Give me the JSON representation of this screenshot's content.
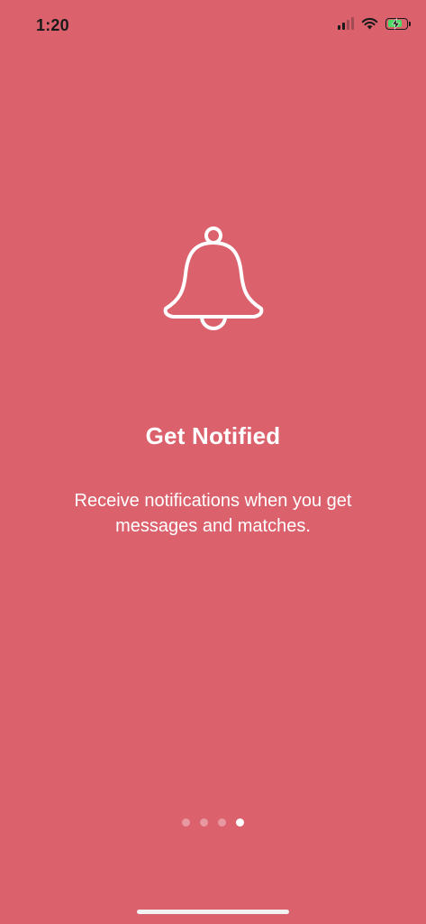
{
  "status_bar": {
    "time": "1:20",
    "signal_icon": "cellular-signal-icon",
    "wifi_icon": "wifi-icon",
    "battery_icon": "battery-charging-icon",
    "signal_bars_active": 2,
    "signal_bars_total": 4,
    "battery_level": 0.8
  },
  "onboarding": {
    "icon": "bell-icon",
    "title": "Get Notified",
    "description": "Receive notifications when you get messages and matches."
  },
  "pagination": {
    "total_pages": 4,
    "current_page": 4
  },
  "colors": {
    "background": "#db616d",
    "text": "#ffffff",
    "status_text": "#1a1a1a",
    "battery_charging": "#4cd964"
  }
}
